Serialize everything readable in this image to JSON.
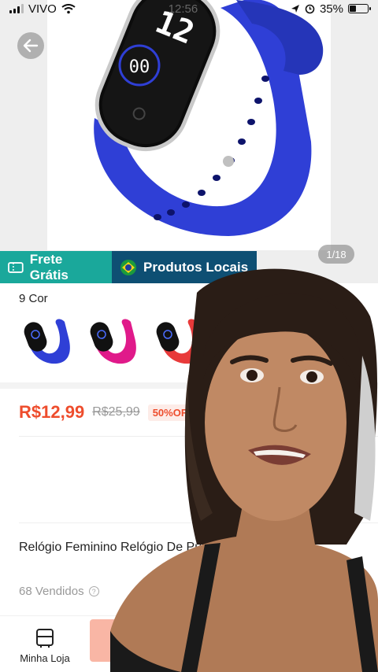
{
  "status_bar": {
    "carrier": "VIVO",
    "time": "12:56",
    "battery": "35%",
    "battery_level": 0.35
  },
  "product_image": {
    "counter": "1/18",
    "watch_display": "12"
  },
  "badges": {
    "shipping": "Frete Grátis",
    "local": "Produtos Locais"
  },
  "variants": {
    "title": "9 Cor",
    "swatches": [
      {
        "color": "#2f3fd6"
      },
      {
        "color": "#e01a8a"
      },
      {
        "color": "#e83a3a"
      }
    ]
  },
  "pricing": {
    "price": "R$12,99",
    "original": "R$25,99",
    "discount": "50%OFF"
  },
  "product": {
    "title": "Relógio Feminino Relógio De Pulso",
    "sold": "68 Vendidos"
  },
  "bottom_bar": {
    "store_label": "Minha Loja"
  },
  "colors": {
    "accent": "#ee4d2d",
    "ship_badge": "#1aa89b",
    "local_badge": "#0e4f73",
    "watch_strap": "#2f3fd6"
  }
}
